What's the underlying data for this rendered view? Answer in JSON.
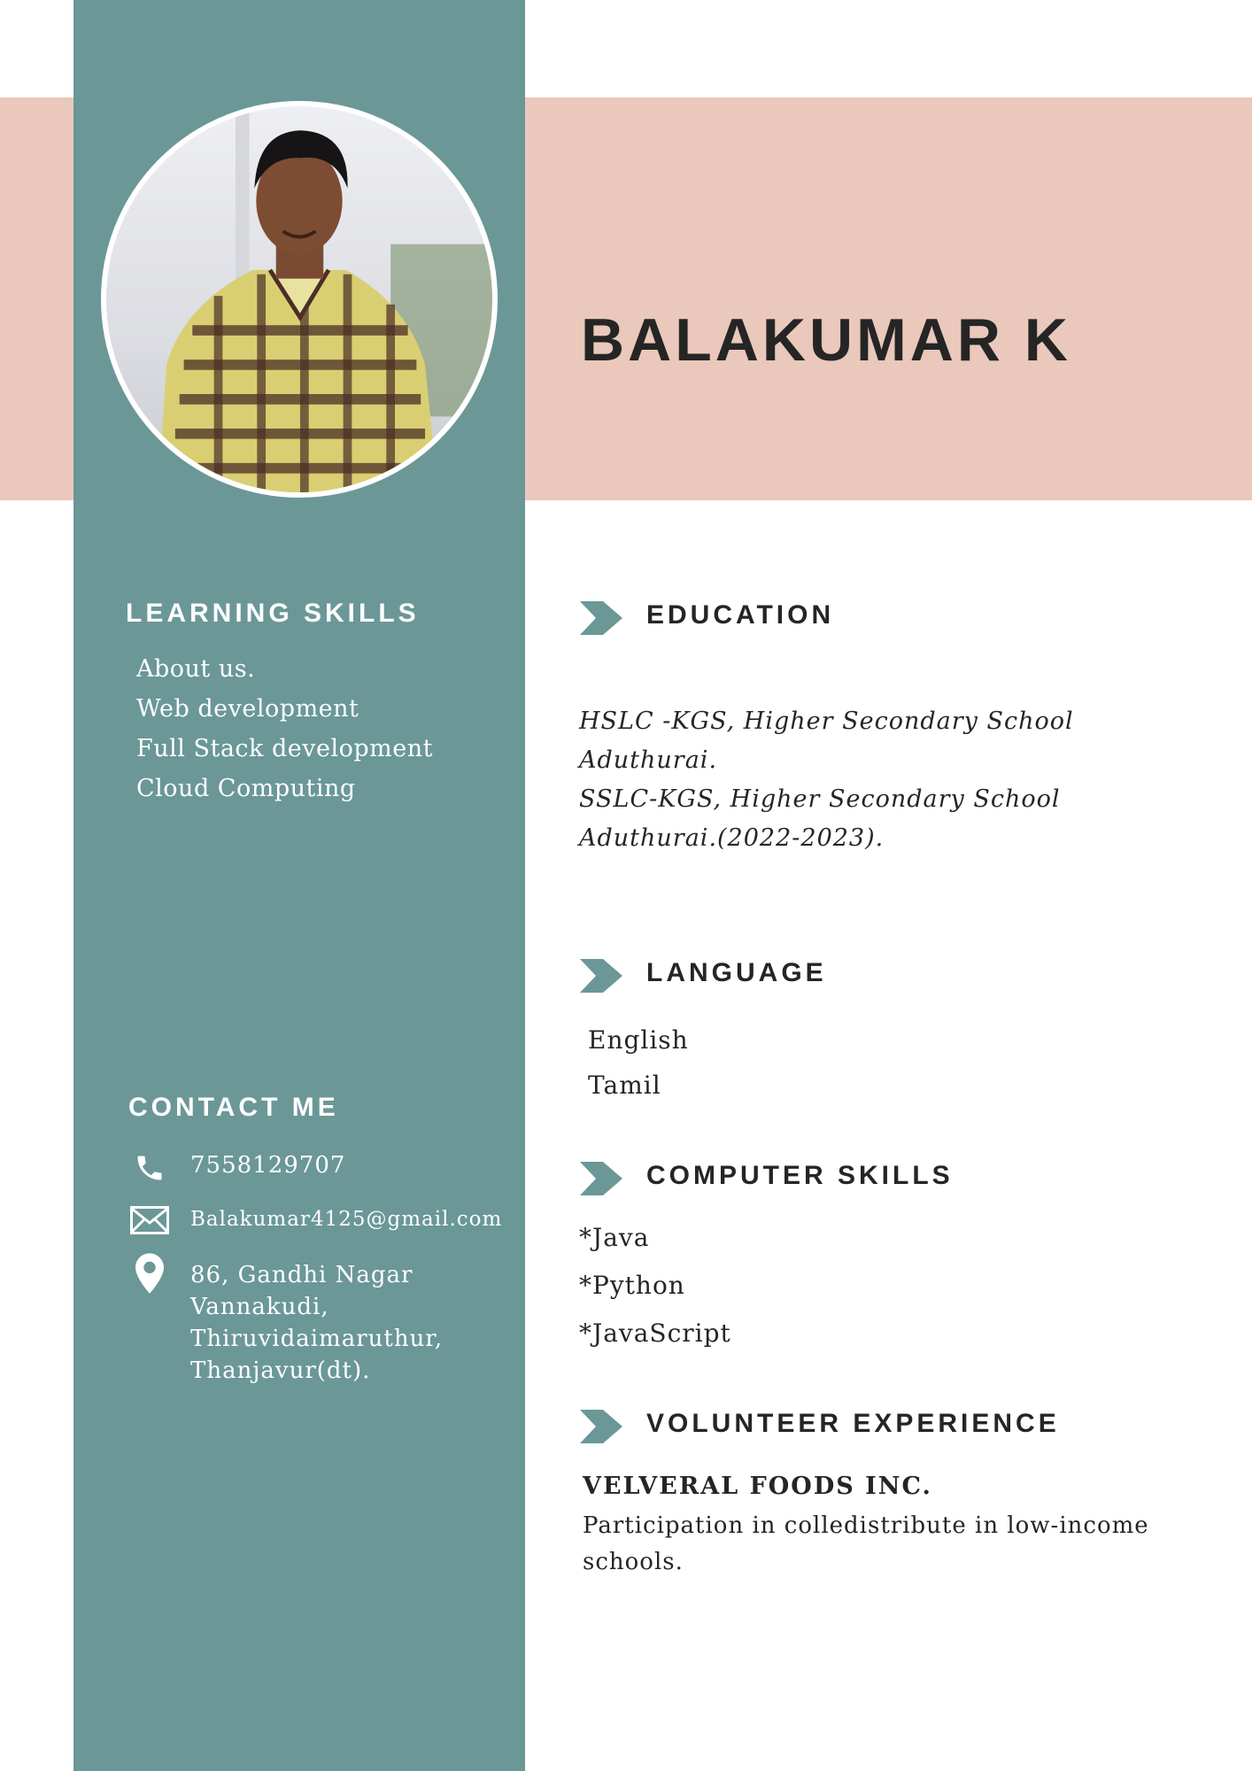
{
  "header": {
    "name": "BALAKUMAR K"
  },
  "learning_skills": {
    "heading": "LEARNING SKILLS",
    "items": [
      "About us.",
      "Web development",
      "Full Stack development",
      "Cloud Computing"
    ]
  },
  "contact": {
    "heading": "CONTACT ME",
    "phone": "7558129707",
    "email": "Balakumar4125@gmail.com",
    "address": [
      "86, Gandhi Nagar",
      "Vannakudi,",
      "Thiruvidaimaruthur,",
      "Thanjavur(dt)."
    ]
  },
  "education": {
    "heading": "EDUCATION",
    "lines": [
      "HSLC -KGS, Higher Secondary School",
      "Aduthurai.",
      "SSLC-KGS, Higher Secondary School",
      "Aduthurai.(2022-2023)."
    ]
  },
  "language": {
    "heading": "LANGUAGE",
    "items": [
      "English",
      "Tamil"
    ]
  },
  "computer_skills": {
    "heading": "COMPUTER SKILLS",
    "items": [
      "*Java",
      "*Python",
      "*JavaScript"
    ]
  },
  "volunteer": {
    "heading": "VOLUNTEER EXPERIENCE",
    "org": "VELVERAL FOODS INC.",
    "description": [
      "Participation in colledistribute in low-income",
      "schools."
    ]
  },
  "colors": {
    "sidebar": "#6b9797",
    "band": "#eac8bb",
    "text": "#252525"
  },
  "icons": {
    "phone": "phone-icon",
    "email": "envelope-icon",
    "address": "location-pin-icon",
    "section": "chevron-arrow-icon"
  }
}
